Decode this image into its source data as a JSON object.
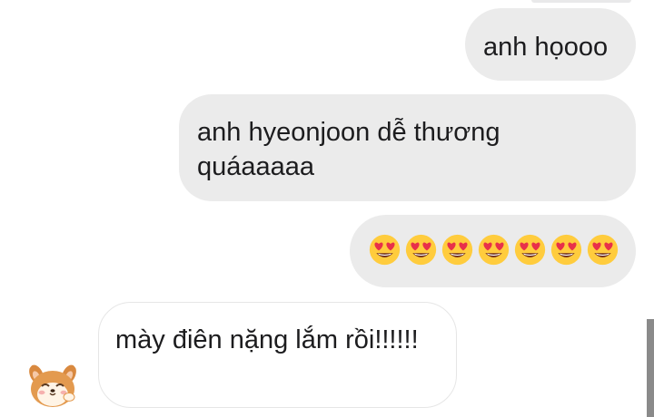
{
  "conversation": {
    "messages": [
      {
        "direction": "outgoing",
        "text": "anh họooo"
      },
      {
        "direction": "outgoing",
        "text": "anh hyeonjoon dễ thương quáaaaaa"
      },
      {
        "direction": "outgoing",
        "emoji": "heart-eyes-emoji",
        "emoji_count": 7
      },
      {
        "direction": "incoming",
        "text": "mày điên nặng lắm rồi!!!!!!"
      }
    ]
  },
  "avatar": {
    "icon": "shiba-dog-avatar-icon"
  },
  "colors": {
    "outgoing_bubble": "#ebebeb",
    "incoming_bubble": "#ffffff",
    "text": "#1c1c1e",
    "emoji_face": "#ffcc3d",
    "emoji_heart": "#e8304a"
  }
}
